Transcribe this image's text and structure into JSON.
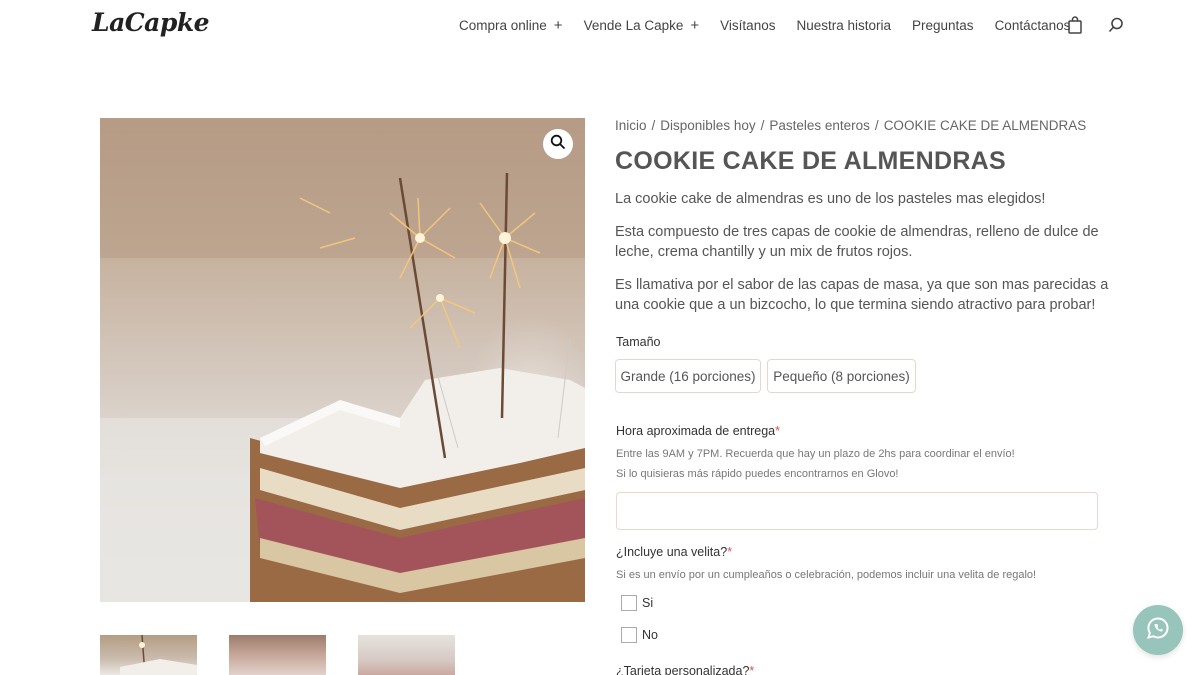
{
  "header": {
    "logo": "LaCapke",
    "nav": [
      {
        "label": "Compra online",
        "plus": "+"
      },
      {
        "label": "Vende La Capke",
        "plus": "+"
      },
      {
        "label": "Visítanos"
      },
      {
        "label": "Nuestra historia"
      },
      {
        "label": "Preguntas"
      },
      {
        "label": "Contáctanos"
      }
    ],
    "cart_icon": "shopping-bag-icon",
    "search_icon": "search-icon"
  },
  "breadcrumb": {
    "items": [
      "Inicio",
      "Disponibles hoy",
      "Pasteles enteros"
    ],
    "current": "COOKIE CAKE DE ALMENDRAS",
    "separator": "/"
  },
  "product": {
    "title": "COOKIE CAKE DE ALMENDRAS",
    "description": [
      "La cookie cake de almendras es uno de los pasteles mas elegidos!",
      "Esta compuesto de tres capas de cookie de almendras, relleno de dulce de leche, crema chantilly y un mix de frutos rojos.",
      "Es llamativa por el sabor de las capas de masa, ya que son mas parecidas a una cookie que a un bizcocho, lo que termina siendo atractivo para probar!"
    ],
    "size_label": "Tamaño",
    "sizes": [
      "Grande (16 porciones)",
      "Pequeño (8 porciones)"
    ]
  },
  "delivery": {
    "label": "Hora aproximada de entrega",
    "required_mark": "*",
    "help_1": "Entre las 9AM y 7PM. Recuerda que hay un plazo de 2hs para coordinar el envío!",
    "help_2": "Si lo quisieras más rápido puedes encontrarnos en Glovo!",
    "value": ""
  },
  "candle": {
    "label": "¿Incluye una velita?",
    "required_mark": "*",
    "help": "Si es un envío por un cumpleaños o celebración, podemos incluir una velita de regalo!",
    "options": [
      "Si",
      "No"
    ]
  },
  "card": {
    "label": "¿Tarjeta personalizada?",
    "required_mark": "*"
  },
  "icons": {
    "zoom": "magnifier-icon",
    "whatsapp": "whatsapp-icon"
  },
  "colors": {
    "whatsapp_button": "#97c4bb",
    "required": "#d9534f"
  }
}
